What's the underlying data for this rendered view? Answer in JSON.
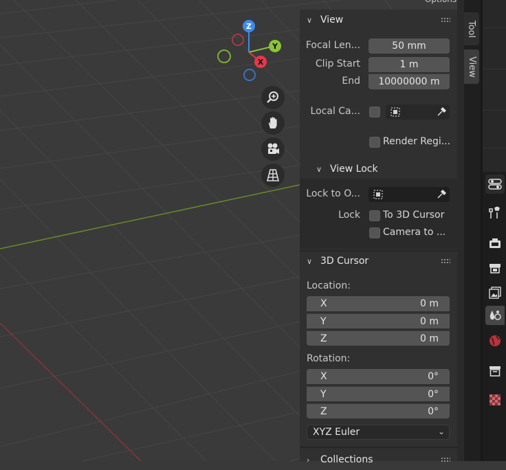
{
  "header": {
    "options_label": "Options"
  },
  "view": {
    "title": "View",
    "focal_length_label": "Focal Len...",
    "focal_length_value": "50 mm",
    "clip_start_label": "Clip Start",
    "clip_start_value": "1 m",
    "clip_end_label": "End",
    "clip_end_value": "10000000 m",
    "local_camera_label": "Local Ca...",
    "render_region_label": "Render Regi..."
  },
  "view_lock": {
    "title": "View Lock",
    "lock_to_object_label": "Lock to O...",
    "lock_label": "Lock",
    "to_3d_cursor_label": "To 3D Cursor",
    "camera_to_view_label": "Camera to ..."
  },
  "cursor": {
    "title": "3D Cursor",
    "location_label": "Location:",
    "location": [
      {
        "axis": "X",
        "value": "0 m"
      },
      {
        "axis": "Y",
        "value": "0 m"
      },
      {
        "axis": "Z",
        "value": "0 m"
      }
    ],
    "rotation_label": "Rotation:",
    "rotation": [
      {
        "axis": "X",
        "value": "0°"
      },
      {
        "axis": "Y",
        "value": "0°"
      },
      {
        "axis": "Z",
        "value": "0°"
      }
    ],
    "rotation_mode": "XYZ Euler"
  },
  "collections": {
    "title": "Collections"
  },
  "tabs": {
    "tool": "Tool",
    "view": "View"
  },
  "gizmo": {
    "z": "Z",
    "y": "Y",
    "x": "X"
  },
  "colors": {
    "x_axis": "#e8374a",
    "y_axis": "#8bc43a",
    "z_axis": "#3b8bea",
    "viewport_bg": "#3a3a3a",
    "panel_bg": "#303030"
  },
  "icons": {
    "navigation": [
      "zoom-icon",
      "pan-hand-icon",
      "camera-view-icon",
      "ortho-grid-icon"
    ],
    "properties": [
      "tool-wrench-icon",
      "render-camera-icon",
      "output-printer-icon",
      "view-layer-icon",
      "scene-icon",
      "world-icon",
      "collection-box-icon",
      "texture-checker-icon"
    ]
  }
}
